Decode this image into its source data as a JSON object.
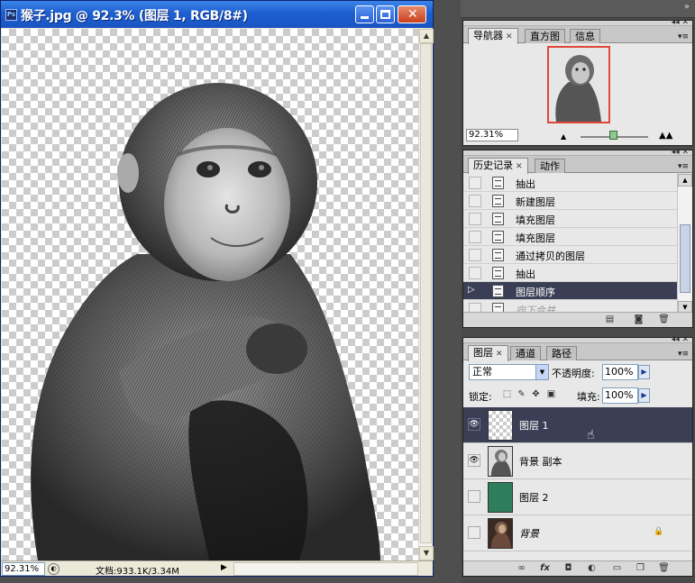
{
  "document": {
    "title": "猴子.jpg @ 92.3% (图层 1, RGB/8#)",
    "app_icon_label": "Ps",
    "status_zoom": "92.31%",
    "status_doc_size": "文档:933.1K/3.34M"
  },
  "navigator": {
    "tabs": [
      "导航器",
      "直方图",
      "信息"
    ],
    "zoom_value": "92.31%"
  },
  "history": {
    "tabs": [
      "历史记录",
      "动作"
    ],
    "items": [
      {
        "label": "抽出"
      },
      {
        "label": "新建图层"
      },
      {
        "label": "填充图层"
      },
      {
        "label": "填充图层"
      },
      {
        "label": "通过拷贝的图层"
      },
      {
        "label": "抽出"
      },
      {
        "label": "图层顺序",
        "current": true
      },
      {
        "label": "向下合并",
        "undone": true
      }
    ]
  },
  "layers": {
    "tabs": [
      "图层",
      "通道",
      "路径"
    ],
    "blend_mode": "正常",
    "opacity_label": "不透明度:",
    "opacity_value": "100%",
    "lock_label": "锁定:",
    "fill_label": "填充:",
    "fill_value": "100%",
    "items": [
      {
        "name": "图层 1",
        "visible": true,
        "selected": true,
        "thumb": "transparent"
      },
      {
        "name": "背景 副本",
        "visible": true,
        "selected": false,
        "thumb": "monkey-bw"
      },
      {
        "name": "图层 2",
        "visible": false,
        "selected": false,
        "thumb": "green-fill",
        "thumb_color": "#2e7d5b"
      },
      {
        "name": "背景",
        "visible": false,
        "selected": false,
        "thumb": "monkey-color",
        "locked": true
      }
    ]
  },
  "icons": {
    "eye": "eye-icon",
    "lock": "lock-icon",
    "panel_menu": "panel-menu-icon",
    "new_layer": "new-layer-icon",
    "trash": "trash-icon"
  }
}
